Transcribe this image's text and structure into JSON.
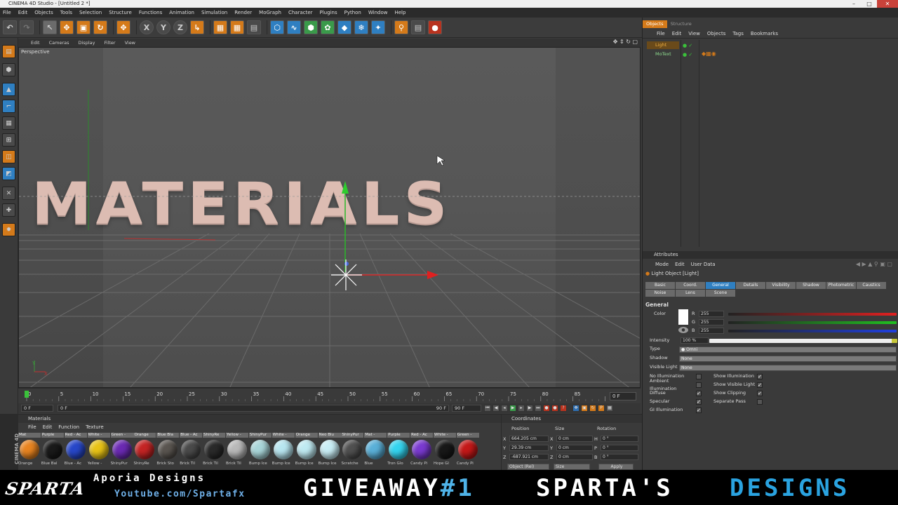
{
  "window": {
    "title": "CINEMA 4D Studio - [Untitled 2 *]"
  },
  "menu": [
    "File",
    "Edit",
    "Objects",
    "Tools",
    "Selection",
    "Structure",
    "Functions",
    "Animation",
    "Simulation",
    "Render",
    "MoGraph",
    "Character",
    "Plugins",
    "Python",
    "Window",
    "Help"
  ],
  "viewport": {
    "menu": [
      "Edit",
      "Cameras",
      "Display",
      "Filter",
      "View"
    ],
    "label": "Perspective",
    "text3d": "MATERIALS"
  },
  "timeline": {
    "ticks": [
      "0",
      "5",
      "10",
      "15",
      "20",
      "25",
      "30",
      "35",
      "40",
      "45",
      "50",
      "55",
      "60",
      "65",
      "70",
      "75",
      "80",
      "85",
      "90"
    ],
    "end_frame": "0 F",
    "start_field": "0 F",
    "start_field2": "0 F",
    "end_field": "90 F",
    "end_field2": "90 F"
  },
  "materials": {
    "header": "Materials",
    "menu": [
      "File",
      "Edit",
      "Function",
      "Texture"
    ],
    "side_label": "CINEMA 4D",
    "items": [
      {
        "top": "Mat",
        "bottom": "Orange",
        "color": "#e88420"
      },
      {
        "top": "Purple",
        "bottom": "Blue Bal",
        "color": "#1a1a1a"
      },
      {
        "top": "Red - Ac",
        "bottom": "Blue - Ac",
        "color": "#2747c9"
      },
      {
        "top": "White - ",
        "bottom": "Yellow - ",
        "color": "#e8c316"
      },
      {
        "top": "Green - ",
        "bottom": "ShinyPur",
        "color": "#6b2ab3"
      },
      {
        "top": "Orange",
        "bottom": "ShinyRe",
        "color": "#c42424"
      },
      {
        "top": "Blue Bla",
        "bottom": "Brick Sto",
        "color": "#5a5550"
      },
      {
        "top": "Blue - Ac",
        "bottom": "Brick Til",
        "color": "#4a4a4a"
      },
      {
        "top": "ShinyRe",
        "bottom": "Brick Til",
        "color": "#2a2a2a"
      },
      {
        "top": "Yellow - ",
        "bottom": "Brick Til",
        "color": "#b9b9b9"
      },
      {
        "top": "ShinyPur",
        "bottom": "Bump Ice",
        "color": "#a9d6d9"
      },
      {
        "top": "White - ",
        "bottom": "Bump Ice",
        "color": "#b8e6f0"
      },
      {
        "top": "Orange",
        "bottom": "Bump Ice",
        "color": "#bfeaf2"
      },
      {
        "top": "Neo Blu",
        "bottom": "Bump Ice",
        "color": "#c9eef6"
      },
      {
        "top": "ShinyPur",
        "bottom": "Scratche",
        "color": "#505050"
      },
      {
        "top": "Mat - ",
        "bottom": "Blue",
        "color": "#5ab0d8"
      },
      {
        "top": "Purple",
        "bottom": "Tron Glo",
        "color": "#34d4ef"
      },
      {
        "top": "Red - Ac",
        "bottom": "Candy Pi",
        "color": "#7a3ad0"
      },
      {
        "top": "White - ",
        "bottom": "Hope Gl",
        "color": "#181818"
      },
      {
        "top": "Green - ",
        "bottom": "Candy Pi",
        "color": "#c41818"
      }
    ]
  },
  "coordinates": {
    "header": "Coordinates",
    "col_headers": [
      "Position",
      "Size",
      "Rotation"
    ],
    "rows": [
      {
        "axis": "X",
        "pos": "664.205 cm",
        "size_axis": "X",
        "size": "0 cm",
        "rot_axis": "H",
        "rot": "0 °"
      },
      {
        "axis": "Y",
        "pos": "29.39 cm",
        "size_axis": "Y",
        "size": "0 cm",
        "rot_axis": "P",
        "rot": "0 °"
      },
      {
        "axis": "Z",
        "pos": "-687.921 cm",
        "size_axis": "Z",
        "size": "0 cm",
        "rot_axis": "B",
        "rot": "0 °"
      }
    ],
    "mode": "Object (Rel)",
    "size_mode": "Size",
    "apply": "Apply"
  },
  "object_manager": {
    "tabs": [
      "Objects",
      "Structure"
    ],
    "menu": [
      "File",
      "Edit",
      "View",
      "Objects",
      "Tags",
      "Bookmarks"
    ],
    "objects": [
      "Light",
      "MoText"
    ]
  },
  "attributes": {
    "header": "Attributes",
    "menu": [
      "Mode",
      "Edit",
      "User Data"
    ],
    "title": "Light Object [Light]",
    "tabs": [
      "Basic",
      "Coord.",
      "General",
      "Details",
      "Visibility",
      "Shadow",
      "Photometric",
      "Caustics",
      "Noise",
      "Lens",
      "Scene"
    ],
    "active_tab": "General",
    "section": "General",
    "color_label": "Color",
    "rgb": [
      {
        "ch": "R",
        "val": "255",
        "color": "#e02020"
      },
      {
        "ch": "G",
        "val": "255",
        "color": "#20c020"
      },
      {
        "ch": "B",
        "val": "255",
        "color": "#2040e0"
      }
    ],
    "intensity_label": "Intensity",
    "intensity": "100 %",
    "type_label": "Type",
    "type": "Omni",
    "shadow_label": "Shadow",
    "shadow": "None",
    "visible_light_label": "Visible Light",
    "visible_light": "None",
    "checks_left": [
      {
        "label": "No Illumination",
        "checked": false
      },
      {
        "label": "Ambient Illumination",
        "checked": false
      },
      {
        "label": "Diffuse",
        "checked": true
      },
      {
        "label": "Specular",
        "checked": true
      },
      {
        "label": "GI Illumination",
        "checked": true
      }
    ],
    "checks_right": [
      {
        "label": "Show Illumination",
        "checked": true
      },
      {
        "label": "Show Visible Light",
        "checked": true
      },
      {
        "label": "Show Clipping",
        "checked": true
      },
      {
        "label": "Separate Pass",
        "checked": false
      }
    ]
  },
  "banner": {
    "logo": "SPARTA",
    "aporia": "Aporia Designs",
    "youtube": "Youtube.com/Spartafx",
    "giveaway": "GIVEAWAY",
    "giveaway_num": "#1",
    "spartas": "SPARTA'S",
    "designs": "DESIGNS"
  }
}
